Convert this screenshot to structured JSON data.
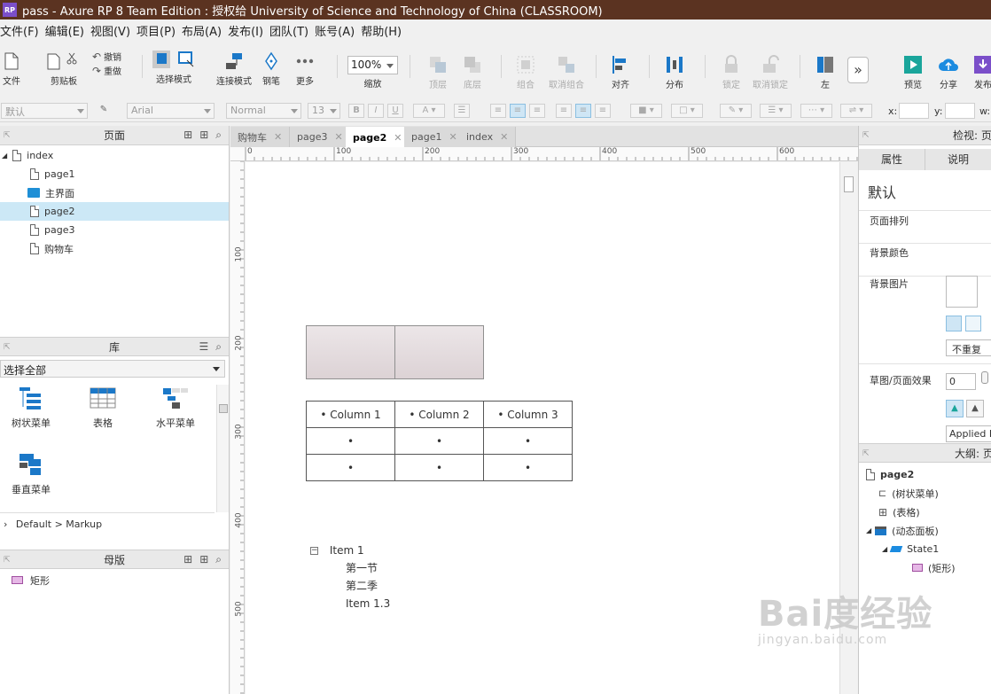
{
  "app": {
    "logo": "RP",
    "title": "pass - Axure RP 8 Team Edition : 授权给 University of Science and Technology of China (CLASSROOM)"
  },
  "menubar": [
    "文件(F)",
    "编辑(E)",
    "视图(V)",
    "项目(P)",
    "布局(A)",
    "发布(I)",
    "团队(T)",
    "账号(A)",
    "帮助(H)"
  ],
  "toolbar": {
    "file": "文件",
    "clipboard": "剪贴板",
    "undo": "撤销",
    "redo": "重做",
    "select_mode": "选择模式",
    "connect_mode": "连接模式",
    "pen": "钢笔",
    "more": "更多",
    "zoom_value": "100%",
    "zoom": "缩放",
    "top": "顶层",
    "bottom": "底层",
    "group": "组合",
    "ungroup": "取消组合",
    "align": "对齐",
    "distribute": "分布",
    "lock": "锁定",
    "unlock": "取消锁定",
    "left": "左",
    "preview": "预览",
    "share": "分享",
    "publish": "发布"
  },
  "formatbar": {
    "style": "默认",
    "font": "Arial",
    "weight": "Normal",
    "size": "13",
    "x_label": "x:",
    "y_label": "y:",
    "w_label": "w:"
  },
  "pages_panel": {
    "title": "页面",
    "items": [
      {
        "label": "index",
        "type": "page",
        "level": 0
      },
      {
        "label": "page1",
        "type": "page",
        "level": 1
      },
      {
        "label": "主界面",
        "type": "folder",
        "level": 1
      },
      {
        "label": "page2",
        "type": "page",
        "level": 1,
        "selected": true
      },
      {
        "label": "page3",
        "type": "page",
        "level": 1
      },
      {
        "label": "购物车",
        "type": "page",
        "level": 1
      }
    ]
  },
  "library_panel": {
    "title": "库",
    "select": "选择全部",
    "items": [
      "树状菜单",
      "表格",
      "水平菜单",
      "垂直菜单"
    ],
    "footer": "Default > Markup"
  },
  "masters_panel": {
    "title": "母版",
    "items": [
      "矩形"
    ]
  },
  "tabs": [
    {
      "label": "购物车",
      "active": false
    },
    {
      "label": "page3",
      "active": false
    },
    {
      "label": "page2",
      "active": true
    },
    {
      "label": "page1",
      "active": false
    },
    {
      "label": "index",
      "active": false
    }
  ],
  "ruler": {
    "h": [
      "0",
      "100",
      "200",
      "300",
      "400",
      "500",
      "600"
    ],
    "v": [
      "100",
      "200",
      "300",
      "400",
      "500"
    ]
  },
  "canvas": {
    "table": {
      "headers": [
        "• Column 1",
        "• Column 2",
        "• Column 3"
      ],
      "rows": [
        [
          "•",
          "•",
          "•"
        ],
        [
          "•",
          "•",
          "•"
        ]
      ]
    },
    "tree": {
      "toggle": "−",
      "root": "Item 1",
      "children": [
        "第一节",
        "第二季",
        "Item 1.3"
      ]
    }
  },
  "inspector": {
    "title": "检视: 页面",
    "tabs": [
      "属性",
      "说明"
    ],
    "style_name": "默认",
    "rows": [
      "页面排列",
      "背景颜色",
      "背景图片"
    ],
    "repeat": "不重复",
    "sketch_label": "草图/页面效果",
    "sketch_value": "0",
    "applied": "Applied Fo"
  },
  "outline": {
    "title": "大纲: 页面",
    "items": [
      {
        "label": "page2",
        "level": 0
      },
      {
        "label": "(树状菜单)",
        "level": 1
      },
      {
        "label": "(表格)",
        "level": 1
      },
      {
        "label": "(动态面板)",
        "level": 1
      },
      {
        "label": "State1",
        "level": 2
      },
      {
        "label": "(矩形)",
        "level": 3
      }
    ]
  },
  "watermark": {
    "brand": "Bai度经验",
    "url": "jingyan.baidu.com"
  }
}
